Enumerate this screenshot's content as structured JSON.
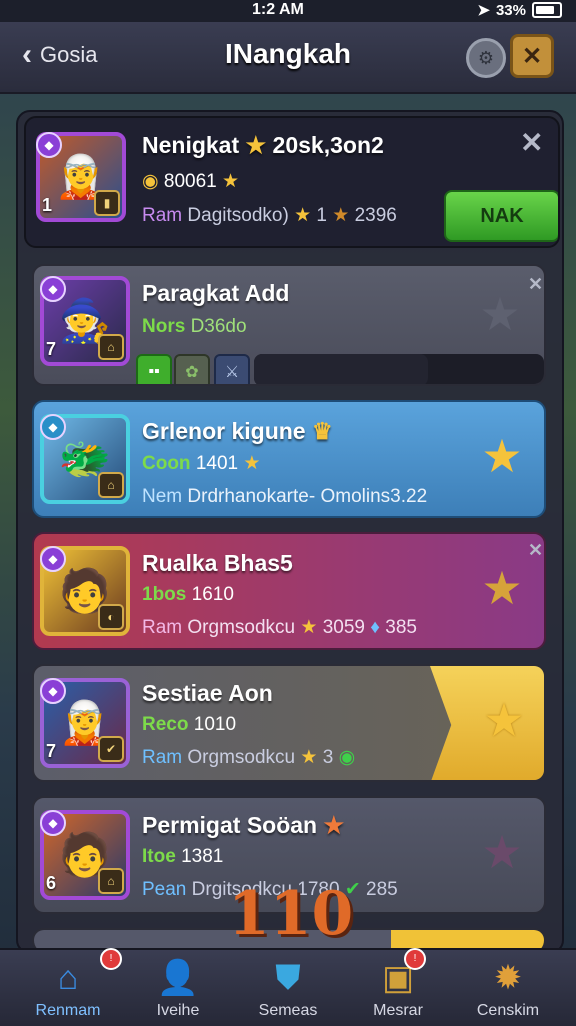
{
  "status": {
    "time": "1:2 AM",
    "battery": "33%"
  },
  "header": {
    "back_label": "Gosia",
    "title": "INangkah"
  },
  "cards": [
    {
      "name": "Nenigkat",
      "name_extra": "20sk,3on2",
      "sub_value": "80061",
      "line3_prefix": "Ram",
      "line3_text": "Dagitsodko)",
      "stat1": "1",
      "stat2": "2396",
      "level": "1",
      "button": "NAK",
      "avatar_color": "#a24ad6"
    },
    {
      "name": "Paragkat Add",
      "sub_tag": "Nors",
      "sub_value": "D36do",
      "level": "7"
    },
    {
      "name": "Grlenor kigune",
      "sub_tag": "Coon",
      "sub_value": "1401",
      "line3_prefix": "Nem",
      "line3_text": "Drdrhanokarte-",
      "line3_extra": "Omolins3.22"
    },
    {
      "name": "Rualka Bhas5",
      "sub_tag": "1bos",
      "sub_value": "1610",
      "line3_prefix": "Ram",
      "line3_text": "Orgmsodkcu",
      "stat1": "3059",
      "stat2": "385"
    },
    {
      "name": "Sestiae Aon",
      "sub_tag": "Reco",
      "sub_value": "1010",
      "line3_prefix": "Ram",
      "line3_text": "Orgmsodkcu",
      "stat1": "3",
      "level": "7"
    },
    {
      "name": "Permigat Soöan",
      "sub_tag": "Itoe",
      "sub_value": "1381",
      "line3_prefix": "Pean",
      "line3_text": "Drgitsodkcu",
      "stat1": "1780",
      "stat2": "285",
      "level": "6"
    }
  ],
  "emblem": "110",
  "tabs": [
    {
      "label": "Renmam",
      "icon": "home-icon"
    },
    {
      "label": "Iveihe",
      "icon": "profile-icon"
    },
    {
      "label": "Semeas",
      "icon": "shield-icon"
    },
    {
      "label": "Mesrar",
      "icon": "chest-icon"
    },
    {
      "label": "Censkim",
      "icon": "gear-icon"
    }
  ],
  "colors": {
    "accent_green": "#3fae2c",
    "gold": "#f5c33b",
    "blue_card": "#4a90c8",
    "purple_card": "#9c3f7a",
    "yellow_card": "#f0c237"
  }
}
